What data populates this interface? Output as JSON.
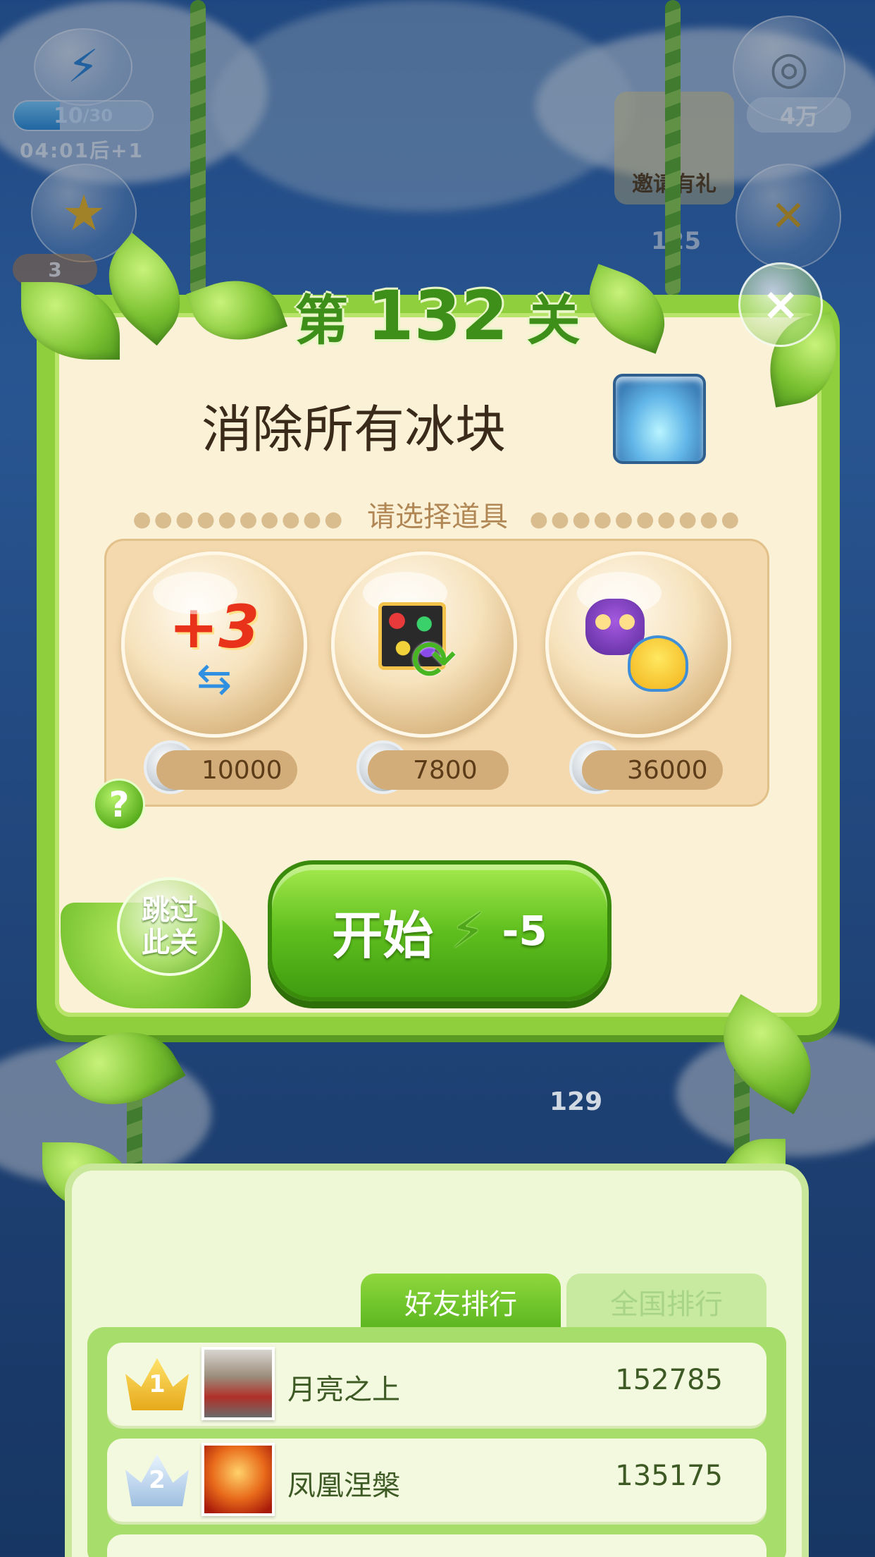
{
  "hud": {
    "energy_current": "10",
    "energy_max": "/30",
    "energy_fraction": 0.33,
    "timer": "04:01后+1",
    "coins_label": "4万",
    "invite_label": "邀请有礼",
    "level_marker_top": "125",
    "level_marker_bottom": "129",
    "star_count": "3"
  },
  "dialog": {
    "title_prefix": "第",
    "level_number": "132",
    "title_suffix": "关",
    "objective": "消除所有冰块",
    "select_label": "请选择道具",
    "props": [
      {
        "name": "plus-three-moves",
        "icon_text": "+3",
        "price": "10000"
      },
      {
        "name": "shuffle",
        "icon_text": "",
        "price": "7800"
      },
      {
        "name": "owl-chick",
        "icon_text": "",
        "price": "36000"
      }
    ],
    "help": "?",
    "skip_line1": "跳过",
    "skip_line2": "此关",
    "start_label": "开始",
    "start_cost": "-5",
    "close": "×"
  },
  "ranking": {
    "tab_friends": "好友排行",
    "tab_national": "全国排行",
    "rows": [
      {
        "rank": "1",
        "name": "月亮之上",
        "score": "152785"
      },
      {
        "rank": "2",
        "name": "凤凰涅槃",
        "score": "135175"
      }
    ]
  },
  "colors": {
    "accent_green": "#5fbf1e",
    "panel_bg": "#fbf1d7",
    "sky": "#2c5fa6"
  }
}
